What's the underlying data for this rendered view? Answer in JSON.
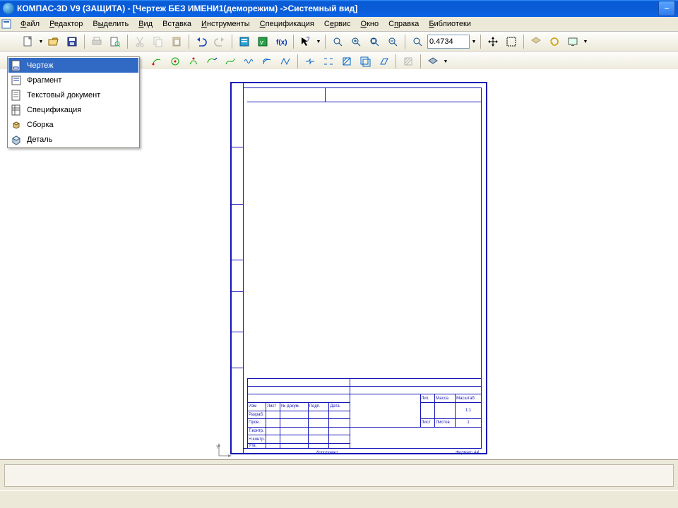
{
  "title": "КОМПАС-3D V9 (ЗАЩИТА) - [Чертеж БЕЗ ИМЕНИ1(деморежим) ->Системный вид]",
  "menu": {
    "file": {
      "pre": "",
      "ul": "Ф",
      "post": "айл"
    },
    "editor": {
      "pre": "",
      "ul": "Р",
      "post": "едактор"
    },
    "select": {
      "pre": "В",
      "ul": "ы",
      "post": "делить"
    },
    "view": {
      "pre": "",
      "ul": "В",
      "post": "ид"
    },
    "insert": {
      "pre": "Вст",
      "ul": "а",
      "post": "вка"
    },
    "tools": {
      "pre": "",
      "ul": "И",
      "post": "нструменты"
    },
    "spec": {
      "pre": "",
      "ul": "С",
      "post": "пецификация"
    },
    "service": {
      "pre": "С",
      "ul": "е",
      "post": "рвис"
    },
    "window": {
      "pre": "",
      "ul": "О",
      "post": "кно"
    },
    "help": {
      "pre": "С",
      "ul": "п",
      "post": "равка"
    },
    "libs": {
      "pre": "",
      "ul": "Б",
      "post": "иблиотеки"
    }
  },
  "zoom_value": "0.4734",
  "new_menu": {
    "drawing": "Чертеж",
    "fragment": "Фрагмент",
    "textdoc": "Текстовый документ",
    "spec": "Спецификация",
    "assembly": "Сборка",
    "part": "Деталь"
  },
  "stamp": {
    "r1": {
      "c1": "Изм",
      "c2": "Лист",
      "c3": "№ докум.",
      "c4": "Подп.",
      "c5": "Дата"
    },
    "r2": "Разраб.",
    "r3": "Пров.",
    "r4": "Т.контр.",
    "r5": "Н.контр.",
    "r6": "Утв.",
    "hdr": {
      "lit": "Лит.",
      "massa": "Масса",
      "masht": "Масштаб",
      "val": "1:1",
      "list": "Лист",
      "listov": "Листов",
      "one": "1"
    },
    "footer": {
      "kopiroval": "Копировал",
      "format": "Формат   А4"
    }
  }
}
